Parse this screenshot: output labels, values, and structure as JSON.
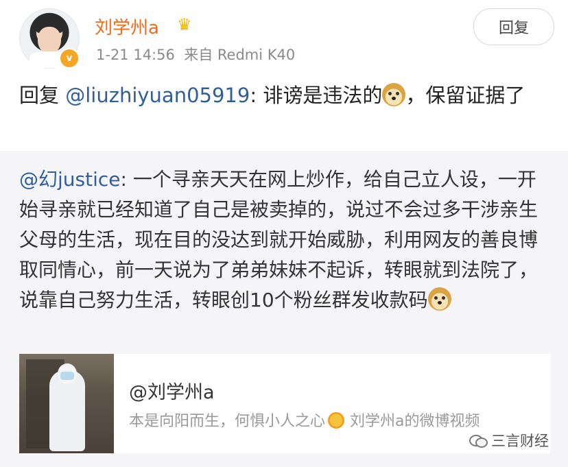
{
  "post": {
    "username": "刘学州a",
    "timestamp": "1-21 14:56",
    "source": "来自 Redmi K40",
    "reply_button": "回复",
    "text_prefix": "回复",
    "mention": "@liuzhiyuan05919",
    "text_body": ": 诽谤是违法的",
    "text_suffix": "，保留证据了"
  },
  "quoted": {
    "author_mention": "@幻justice",
    "text": ": 一个寻亲天天在网上炒作，给自己立人设，一开始寻亲就已经知道了自己是被卖掉的，说过不会过多干涉亲生父母的生活，现在目的没达到就开始威胁，利用网友的善良博取同情心，前一天说为了弟弟妹妹不起诉，转眼就到法院了，说靠自己努力生活，转眼创10个粉丝群发收款码"
  },
  "card": {
    "title": "@刘学州a",
    "desc_part1": "本是向阳而生，何惧小人之心",
    "desc_part2": "刘学州a的微博视频"
  },
  "watermark": "三言财经",
  "icons": {
    "crown": "crown-icon",
    "verified": "verified-badge-icon",
    "doge": "doge-emoji-icon",
    "sun": "sun-emoji-icon"
  },
  "colors": {
    "username": "#f26b1d",
    "mention": "#2f5e9a",
    "quote_bg": "#f5f5f7"
  }
}
